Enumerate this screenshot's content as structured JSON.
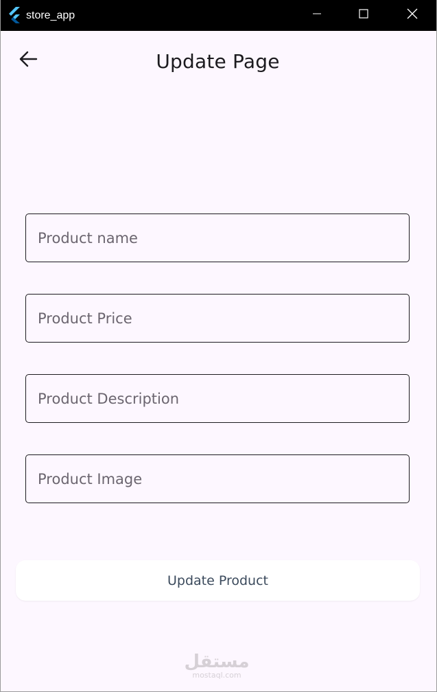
{
  "window": {
    "title": "store_app"
  },
  "header": {
    "title": "Update Page"
  },
  "form": {
    "fields": [
      {
        "placeholder": "Product name",
        "value": ""
      },
      {
        "placeholder": "Product Price",
        "value": ""
      },
      {
        "placeholder": "Product Description",
        "value": ""
      },
      {
        "placeholder": "Product Image",
        "value": ""
      }
    ],
    "submit_label": "Update Product"
  },
  "watermark": {
    "arabic": "مستقل",
    "latin": "mostaql.com"
  },
  "colors": {
    "background": "#fdf7ff",
    "titlebar": "#000000",
    "text": "#1c1b1f",
    "placeholder": "#6b656f",
    "button_text": "#3b4a5c",
    "flutter_light": "#54c5f8",
    "flutter_dark": "#01579b"
  },
  "icons": {
    "app": "flutter-logo-icon",
    "minimize": "minimize-icon",
    "maximize": "maximize-icon",
    "close": "close-icon",
    "back": "arrow-back-icon"
  }
}
